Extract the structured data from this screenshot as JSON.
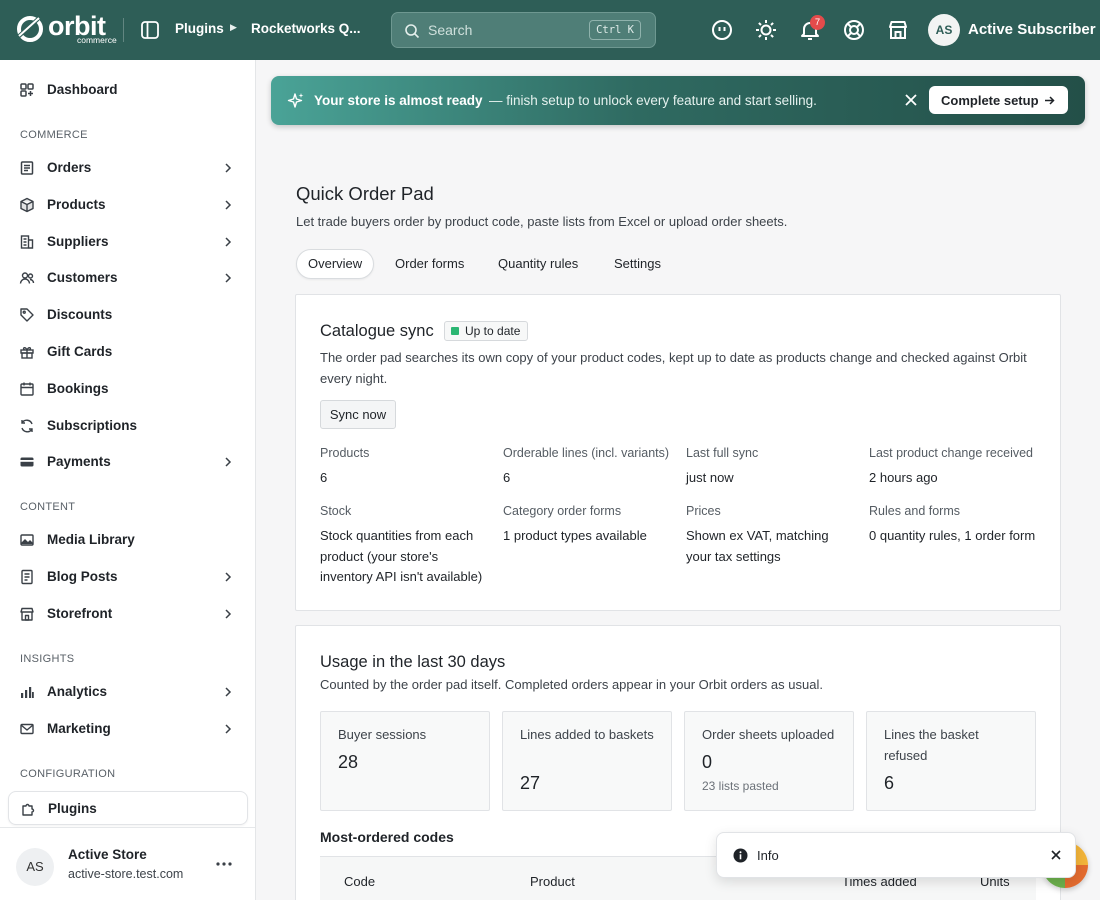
{
  "app": {
    "logo_word": "orbit",
    "logo_sub": "commerce"
  },
  "topbar": {
    "breadcrumb": [
      "Plugins",
      "Rocketworks Q..."
    ],
    "search_placeholder": "Search",
    "search_shortcut": "Ctrl K",
    "notifications_count": "7",
    "user_initials": "AS",
    "user_name": "Active Subscriber",
    "icons": [
      "smile-icon",
      "sun-icon",
      "bell-icon",
      "lifebuoy-icon",
      "store-icon"
    ]
  },
  "sidebar": {
    "dashboard": "Dashboard",
    "sections": {
      "commerce": "COMMERCE",
      "content": "CONTENT",
      "insights": "INSIGHTS",
      "configuration": "CONFIGURATION"
    },
    "items": {
      "orders": "Orders",
      "products": "Products",
      "suppliers": "Suppliers",
      "customers": "Customers",
      "discounts": "Discounts",
      "gift_cards": "Gift Cards",
      "bookings": "Bookings",
      "subscriptions": "Subscriptions",
      "payments": "Payments",
      "media_library": "Media Library",
      "blog_posts": "Blog Posts",
      "storefront": "Storefront",
      "analytics": "Analytics",
      "marketing": "Marketing",
      "plugins": "Plugins"
    },
    "footer": {
      "initials": "AS",
      "store_name": "Active Store",
      "domain": "active-store.test.com"
    }
  },
  "banner": {
    "title": "Your store is almost ready",
    "text": "— finish setup to unlock every feature and start selling.",
    "button": "Complete setup"
  },
  "page": {
    "title": "Quick Order Pad",
    "description": "Let trade buyers order by product code, paste lists from Excel or upload order sheets.",
    "tabs": [
      "Overview",
      "Order forms",
      "Quantity rules",
      "Settings"
    ],
    "active_tab": "Overview"
  },
  "catalogue_sync": {
    "title": "Catalogue sync",
    "status": "Up to date",
    "status_color": "#2bb673",
    "body": "The order pad searches its own copy of your product codes, kept up to date as products change and checked against Orbit every night.",
    "button": "Sync now",
    "stats": [
      {
        "label": "Products",
        "value": "6"
      },
      {
        "label": "Orderable lines (incl. variants)",
        "value": "6"
      },
      {
        "label": "Last full sync",
        "value": "just now"
      },
      {
        "label": "Last product change received",
        "value": "2 hours ago"
      },
      {
        "label": "Stock",
        "value": "Stock quantities from each product (your store's inventory API isn't available)"
      },
      {
        "label": "Category order forms",
        "value": "1 product types available"
      },
      {
        "label": "Prices",
        "value": "Shown ex VAT, matching your tax settings"
      },
      {
        "label": "Rules and forms",
        "value": "0 quantity rules, 1 order form"
      }
    ]
  },
  "usage": {
    "title": "Usage in the last 30 days",
    "description": "Counted by the order pad itself. Completed orders appear in your Orbit orders as usual.",
    "metrics": [
      {
        "label": "Buyer sessions",
        "value": "28",
        "sub": ""
      },
      {
        "label": "Lines added to baskets",
        "value": "27",
        "sub": ""
      },
      {
        "label": "Order sheets uploaded",
        "value": "0",
        "sub": "23 lists pasted"
      },
      {
        "label": "Lines the basket refused",
        "value": "6",
        "sub": ""
      }
    ],
    "most_ordered_title": "Most-ordered codes",
    "columns": [
      "Code",
      "Product",
      "Times added",
      "Units"
    ]
  },
  "toast": {
    "text": "Info"
  },
  "colors": {
    "topbar": "#2e5e57",
    "accent": "#2e5e57",
    "badge": "#e34b4b"
  }
}
